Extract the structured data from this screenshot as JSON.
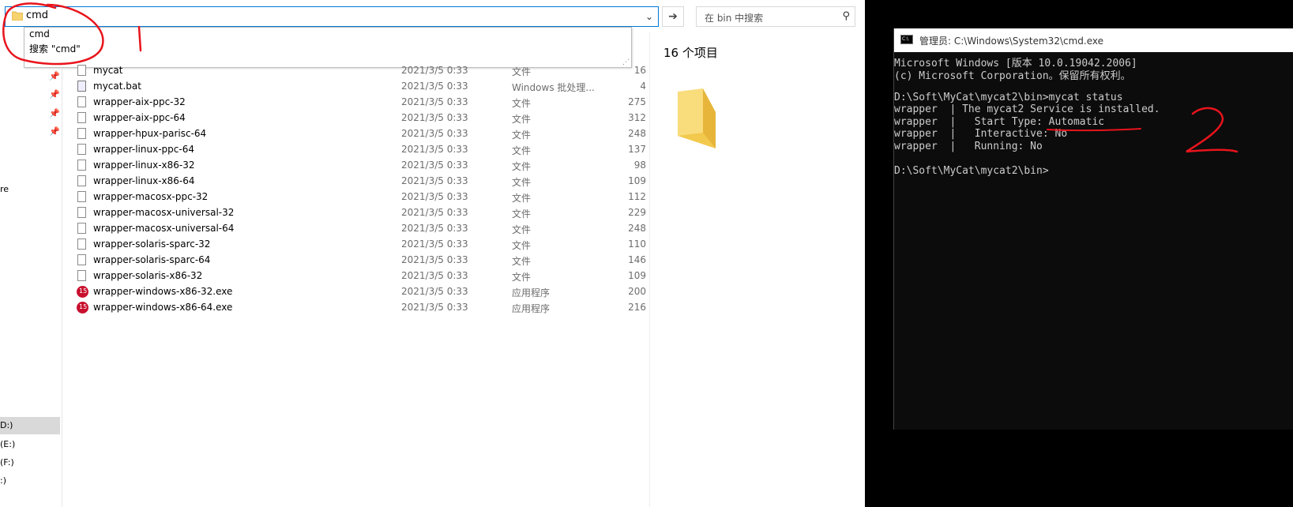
{
  "explorer": {
    "address_value": "cmd",
    "search_placeholder": "在 bin 中搜索",
    "suggestions": [
      "cmd",
      "搜索 \"cmd\""
    ],
    "item_count": "16 个项目",
    "sidebar": {
      "truncated_label": "re",
      "drives": [
        "D:)",
        "(E:)",
        "(F:)",
        ":)"
      ]
    },
    "files": [
      {
        "name": "mycat",
        "date": "2021/3/5 0:33",
        "type": "文件",
        "size": "16",
        "icon": "file-icon"
      },
      {
        "name": "mycat.bat",
        "date": "2021/3/5 0:33",
        "type": "Windows 批处理...",
        "size": "4",
        "icon": "bat-icon"
      },
      {
        "name": "wrapper-aix-ppc-32",
        "date": "2021/3/5 0:33",
        "type": "文件",
        "size": "275",
        "icon": "file-icon"
      },
      {
        "name": "wrapper-aix-ppc-64",
        "date": "2021/3/5 0:33",
        "type": "文件",
        "size": "312",
        "icon": "file-icon"
      },
      {
        "name": "wrapper-hpux-parisc-64",
        "date": "2021/3/5 0:33",
        "type": "文件",
        "size": "248",
        "icon": "file-icon"
      },
      {
        "name": "wrapper-linux-ppc-64",
        "date": "2021/3/5 0:33",
        "type": "文件",
        "size": "137",
        "icon": "file-icon"
      },
      {
        "name": "wrapper-linux-x86-32",
        "date": "2021/3/5 0:33",
        "type": "文件",
        "size": "98",
        "icon": "file-icon"
      },
      {
        "name": "wrapper-linux-x86-64",
        "date": "2021/3/5 0:33",
        "type": "文件",
        "size": "109",
        "icon": "file-icon"
      },
      {
        "name": "wrapper-macosx-ppc-32",
        "date": "2021/3/5 0:33",
        "type": "文件",
        "size": "112",
        "icon": "file-icon"
      },
      {
        "name": "wrapper-macosx-universal-32",
        "date": "2021/3/5 0:33",
        "type": "文件",
        "size": "229",
        "icon": "file-icon"
      },
      {
        "name": "wrapper-macosx-universal-64",
        "date": "2021/3/5 0:33",
        "type": "文件",
        "size": "248",
        "icon": "file-icon"
      },
      {
        "name": "wrapper-solaris-sparc-32",
        "date": "2021/3/5 0:33",
        "type": "文件",
        "size": "110",
        "icon": "file-icon"
      },
      {
        "name": "wrapper-solaris-sparc-64",
        "date": "2021/3/5 0:33",
        "type": "文件",
        "size": "146",
        "icon": "file-icon"
      },
      {
        "name": "wrapper-solaris-x86-32",
        "date": "2021/3/5 0:33",
        "type": "文件",
        "size": "109",
        "icon": "file-icon"
      },
      {
        "name": "wrapper-windows-x86-32.exe",
        "date": "2021/3/5 0:33",
        "type": "应用程序",
        "size": "200",
        "icon": "exe-icon"
      },
      {
        "name": "wrapper-windows-x86-64.exe",
        "date": "2021/3/5 0:33",
        "type": "应用程序",
        "size": "216",
        "icon": "exe-icon"
      }
    ]
  },
  "cmd": {
    "title": "管理员: C:\\Windows\\System32\\cmd.exe",
    "lines": [
      "Microsoft Windows [版本 10.0.19042.2006]",
      "(c) Microsoft Corporation。保留所有权利。",
      "",
      "D:\\Soft\\MyCat\\mycat2\\bin>mycat status",
      "wrapper  | The mycat2 Service is installed.",
      "wrapper  |   Start Type: Automatic",
      "wrapper  |   Interactive: No",
      "wrapper  |   Running: No",
      "",
      "D:\\Soft\\MyCat\\mycat2\\bin>"
    ]
  },
  "annotations": {
    "label_1": "1",
    "label_2": "2",
    "color": "#e8141c"
  },
  "colors": {
    "accent": "#0078d7",
    "folder": "#f7d36f",
    "exe_icon": "#c8102e"
  }
}
